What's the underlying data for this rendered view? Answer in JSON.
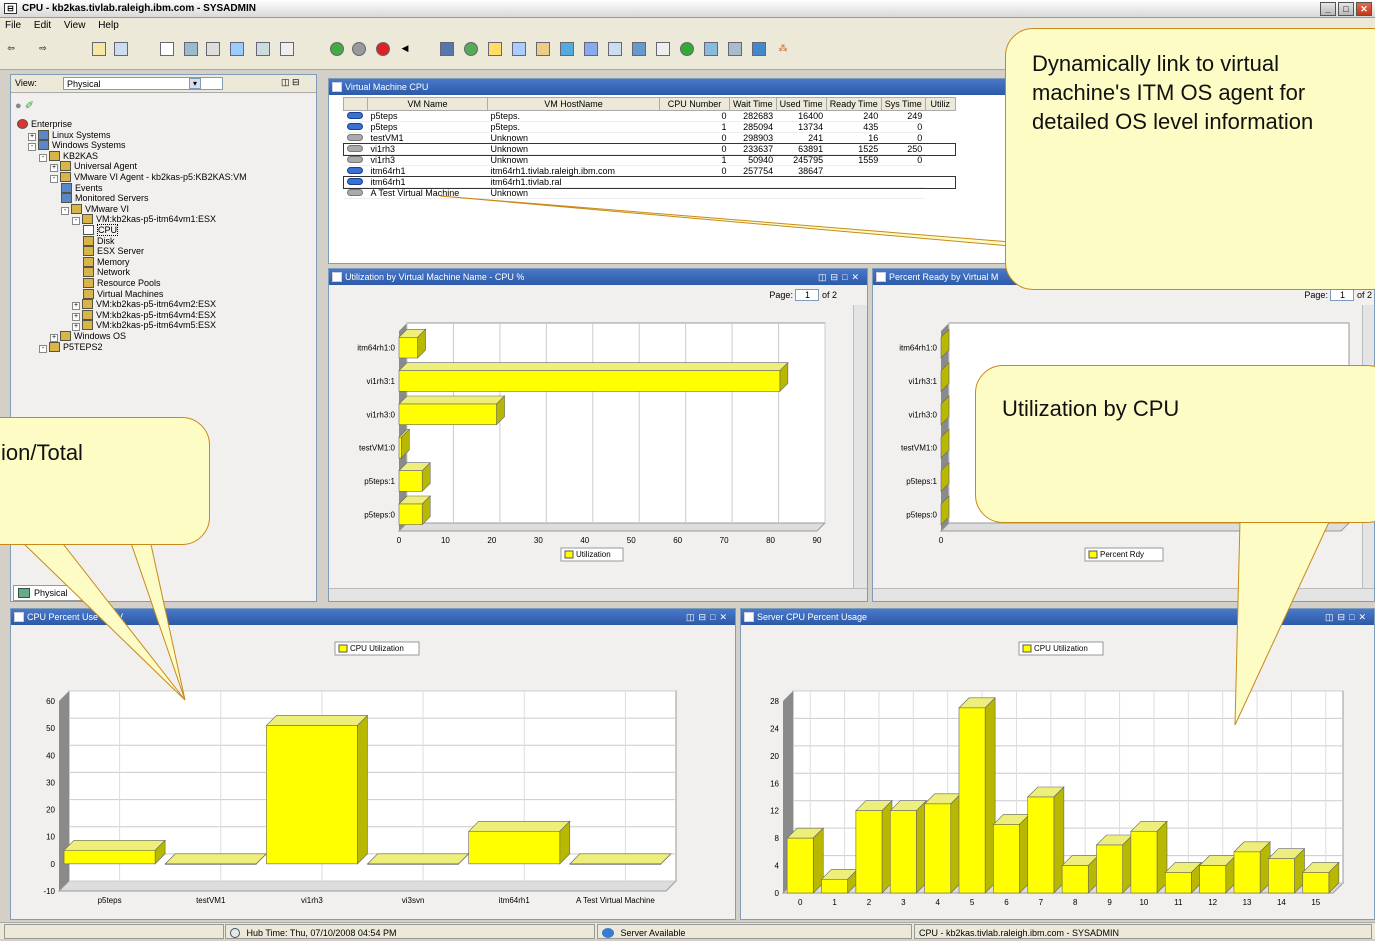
{
  "window": {
    "title": "CPU - kb2kas.tivlab.raleigh.ibm.com - SYSADMIN"
  },
  "menu": [
    "File",
    "Edit",
    "View",
    "Help"
  ],
  "navigator": {
    "view_label": "View:",
    "view_value": "Physical",
    "tab": "Physical",
    "tree": [
      {
        "label": "Enterprise",
        "depth": 0,
        "icon": "red"
      },
      {
        "label": "Linux Systems",
        "depth": 1,
        "icon": "blue",
        "pm": "+"
      },
      {
        "label": "Windows Systems",
        "depth": 1,
        "icon": "blue",
        "pm": "-"
      },
      {
        "label": "KB2KAS",
        "depth": 2,
        "icon": "gold",
        "pm": "-"
      },
      {
        "label": "Universal Agent",
        "depth": 3,
        "icon": "gold",
        "pm": "+"
      },
      {
        "label": "VMware VI Agent - kb2kas-p5:KB2KAS:VM",
        "depth": 3,
        "icon": "gold",
        "pm": "-"
      },
      {
        "label": "Events",
        "depth": 4,
        "icon": "blue"
      },
      {
        "label": "Monitored Servers",
        "depth": 4,
        "icon": "blue"
      },
      {
        "label": "VMware VI",
        "depth": 4,
        "icon": "gold",
        "pm": "-"
      },
      {
        "label": "VM:kb2kas-p5-itm64vm1:ESX",
        "depth": 5,
        "icon": "gold",
        "pm": "-"
      },
      {
        "label": "CPU",
        "depth": 6,
        "icon": "sel"
      },
      {
        "label": "Disk",
        "depth": 6,
        "icon": "gold"
      },
      {
        "label": "ESX Server",
        "depth": 6,
        "icon": "gold"
      },
      {
        "label": "Memory",
        "depth": 6,
        "icon": "gold"
      },
      {
        "label": "Network",
        "depth": 6,
        "icon": "gold"
      },
      {
        "label": "Resource Pools",
        "depth": 6,
        "icon": "gold"
      },
      {
        "label": "Virtual Machines",
        "depth": 6,
        "icon": "gold"
      },
      {
        "label": "VM:kb2kas-p5-itm64vm2:ESX",
        "depth": 5,
        "icon": "gold",
        "pm": "+"
      },
      {
        "label": "VM:kb2kas-p5-itm64vm4:ESX",
        "depth": 5,
        "icon": "gold",
        "pm": "+"
      },
      {
        "label": "VM:kb2kas-p5-itm64vm5:ESX",
        "depth": 5,
        "icon": "gold",
        "pm": "+"
      },
      {
        "label": "Windows OS",
        "depth": 3,
        "icon": "gold",
        "pm": "+"
      },
      {
        "label": "P5TEPS2",
        "depth": 2,
        "icon": "gold",
        "pm": "-"
      }
    ]
  },
  "vm_table": {
    "title": "Virtual Machine CPU",
    "columns": [
      "VM Name",
      "VM HostName",
      "CPU Number",
      "Wait Time",
      "Used Time",
      "Ready Time",
      "Sys Time",
      "Utiliz"
    ],
    "rows": [
      [
        "p5teps",
        "p5teps.",
        "0",
        "282683",
        "16400",
        "240",
        "249"
      ],
      [
        "p5teps",
        "p5teps.",
        "1",
        "285094",
        "13734",
        "435",
        "0"
      ],
      [
        "testVM1",
        "Unknown",
        "0",
        "298903",
        "241",
        "16",
        "0"
      ],
      [
        "vi1rh3",
        "Unknown",
        "0",
        "233637",
        "63891",
        "1525",
        "250"
      ],
      [
        "vi1rh3",
        "Unknown",
        "1",
        "50940",
        "245795",
        "1559",
        "0"
      ],
      [
        "itm64rh1",
        "itm64rh1.tivlab.raleigh.ibm.com",
        "0",
        "257754",
        "38647",
        "",
        ""
      ],
      [
        "itm64rh1",
        "itm64rh1.tivlab.ral",
        "",
        "",
        "",
        "",
        ""
      ],
      [
        "A Test Virtual Machine",
        "Unknown",
        "",
        "",
        "",
        "",
        ""
      ]
    ]
  },
  "util_chart": {
    "title": "Utilization by Virtual Machine Name - CPU %",
    "page_label": "Page:",
    "page_value": "1",
    "page_of": "of 2",
    "legend": "Utilization"
  },
  "ready_chart": {
    "title": "Percent Ready by Virtual M",
    "page_label": "Page:",
    "page_value": "1",
    "page_of": "of 2",
    "legend": "Percent Rdy"
  },
  "cpu_vm_chart": {
    "title": "CPU Percent Use Per V",
    "legend": "CPU Utilization"
  },
  "server_chart": {
    "title": "Server CPU Percent Usage",
    "legend": "CPU Utilization"
  },
  "chart_data": [
    {
      "type": "bar",
      "orientation": "horizontal",
      "title": "Utilization by Virtual Machine Name - CPU %",
      "categories": [
        "itm64rh1:0",
        "vi1rh3:1",
        "vi1rh3:0",
        "testVM1:0",
        "p5teps:1",
        "p5teps:0"
      ],
      "values": [
        4,
        82,
        21,
        0.5,
        5,
        5
      ],
      "xlim": [
        0,
        90
      ],
      "xticks": [
        "0",
        "10",
        "20",
        "30",
        "40",
        "50",
        "60",
        "70",
        "80",
        "90"
      ],
      "legend": [
        "Utilization"
      ]
    },
    {
      "type": "bar",
      "orientation": "horizontal",
      "title": "Percent Ready by Virtual M",
      "categories": [
        "itm64rh1:0",
        "vi1rh3:1",
        "vi1rh3:0",
        "testVM1:0",
        "p5teps:1",
        "p5teps:0"
      ],
      "values": [
        0,
        0,
        0,
        0,
        0,
        0
      ],
      "xticks": [
        "0"
      ],
      "legend": [
        "Percent Rdy"
      ]
    },
    {
      "type": "bar",
      "title": "CPU Percent Use Per V",
      "categories": [
        "p5teps",
        "testVM1",
        "vi1rh3",
        "vi3svn",
        "itm64rh1",
        "A Test Virtual Machine"
      ],
      "values": [
        5,
        0,
        51,
        0,
        12,
        0
      ],
      "ylim": [
        -10,
        60
      ],
      "yticks": [
        "-10",
        "0",
        "10",
        "20",
        "30",
        "40",
        "50",
        "60"
      ],
      "legend": [
        "CPU Utilization"
      ]
    },
    {
      "type": "bar",
      "title": "Server CPU Percent Usage",
      "categories": [
        "0",
        "1",
        "2",
        "3",
        "4",
        "5",
        "6",
        "7",
        "8",
        "9",
        "10",
        "11",
        "12",
        "13",
        "14",
        "15"
      ],
      "values": [
        8,
        2,
        12,
        12,
        13,
        27,
        10,
        14,
        4,
        7,
        9,
        3,
        4,
        6,
        5,
        3
      ],
      "ylim": [
        0,
        28
      ],
      "yticks": [
        "0",
        "4",
        "8",
        "12",
        "16",
        "20",
        "24",
        "28"
      ],
      "legend": [
        "CPU Utilization"
      ]
    }
  ],
  "callouts": {
    "link": "Dynamically link to virtual machine's ITM OS agent for detailed OS level information",
    "cpu": "Utilization by CPU",
    "total": "ion/Total"
  },
  "status": {
    "hub_time": "Hub Time: Thu, 07/10/2008 04:54 PM",
    "server": "Server Available",
    "session": "CPU - kb2kas.tivlab.raleigh.ibm.com - SYSADMIN"
  },
  "colors": {
    "bar": "#ffff00",
    "bar_side": "#b8b800",
    "bar_top": "#eeee7a",
    "header": "#2c5aa8"
  }
}
